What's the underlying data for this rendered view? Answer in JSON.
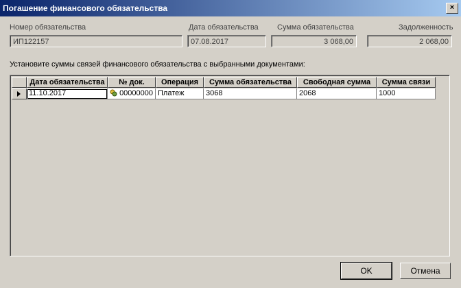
{
  "window": {
    "title": "Погашение финансового обязательства",
    "close_label": "×"
  },
  "fields": {
    "obligation_number": {
      "label": "Номер обязательства",
      "value": "ИП122157"
    },
    "obligation_date": {
      "label": "Дата обязательства",
      "value": "07.08.2017"
    },
    "obligation_sum": {
      "label": "Сумма обязательства",
      "value": "3 068,00"
    },
    "debt": {
      "label": "Задолженность",
      "value": "2 068,00"
    }
  },
  "instruction": "Установите суммы связей финансового обязательства с выбранными документами:",
  "table": {
    "columns": [
      "Дата обязательства",
      "№ док.",
      "Операция",
      "Сумма обязательства",
      "Свободная сумма",
      "Сумма связи"
    ],
    "rows": [
      {
        "date": "11.10.2017",
        "doc": "00000000",
        "operation": "Платеж",
        "obligation_sum": "3068",
        "free_sum": "2068",
        "link_sum": "1000"
      }
    ]
  },
  "buttons": {
    "ok": "OK",
    "cancel": "Отмена"
  }
}
